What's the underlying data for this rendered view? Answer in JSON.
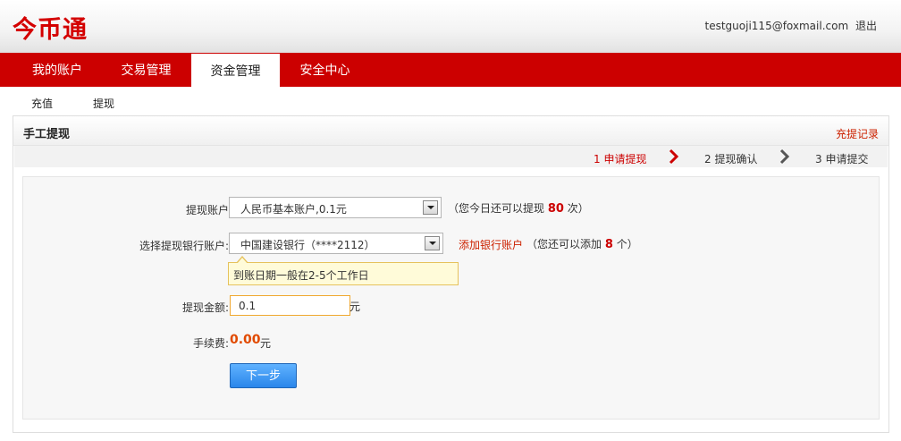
{
  "header": {
    "logo": "今币通",
    "user_email": "testguoji115@foxmail.com",
    "logout_label": "退出",
    "brand_color": "#cc0000"
  },
  "nav": {
    "items": [
      {
        "label": "我的账户"
      },
      {
        "label": "交易管理"
      },
      {
        "label": "资金管理",
        "active": true
      },
      {
        "label": "安全中心"
      }
    ]
  },
  "subnav": {
    "items": [
      {
        "label": "充值"
      },
      {
        "label": "提现"
      }
    ]
  },
  "panel": {
    "title": "手工提现",
    "records_link": "充提记录",
    "steps": [
      {
        "label": "1 申请提现",
        "active": true
      },
      {
        "label": "2 提现确认",
        "active": false
      },
      {
        "label": "3 申请提交",
        "active": false
      }
    ]
  },
  "form": {
    "account": {
      "label": "提现账户",
      "value": "人民币基本账户,0.1元",
      "note_prefix": "（您今日还可以提现",
      "remaining_count": "80",
      "note_suffix": "次）"
    },
    "bank": {
      "label": "选择提现银行账户:",
      "value": "中国建设银行（****2112）",
      "add_link": "添加银行账户",
      "note_prefix": "（您还可以添加",
      "remaining_count": "8",
      "note_suffix": "个）",
      "tooltip": "到账日期一般在2-5个工作日"
    },
    "amount": {
      "label": "提现金额:",
      "value": "0.1",
      "unit": "元"
    },
    "fee": {
      "label": "手续费:",
      "value": "0.00",
      "unit": "元"
    },
    "next_button": "下一步"
  }
}
